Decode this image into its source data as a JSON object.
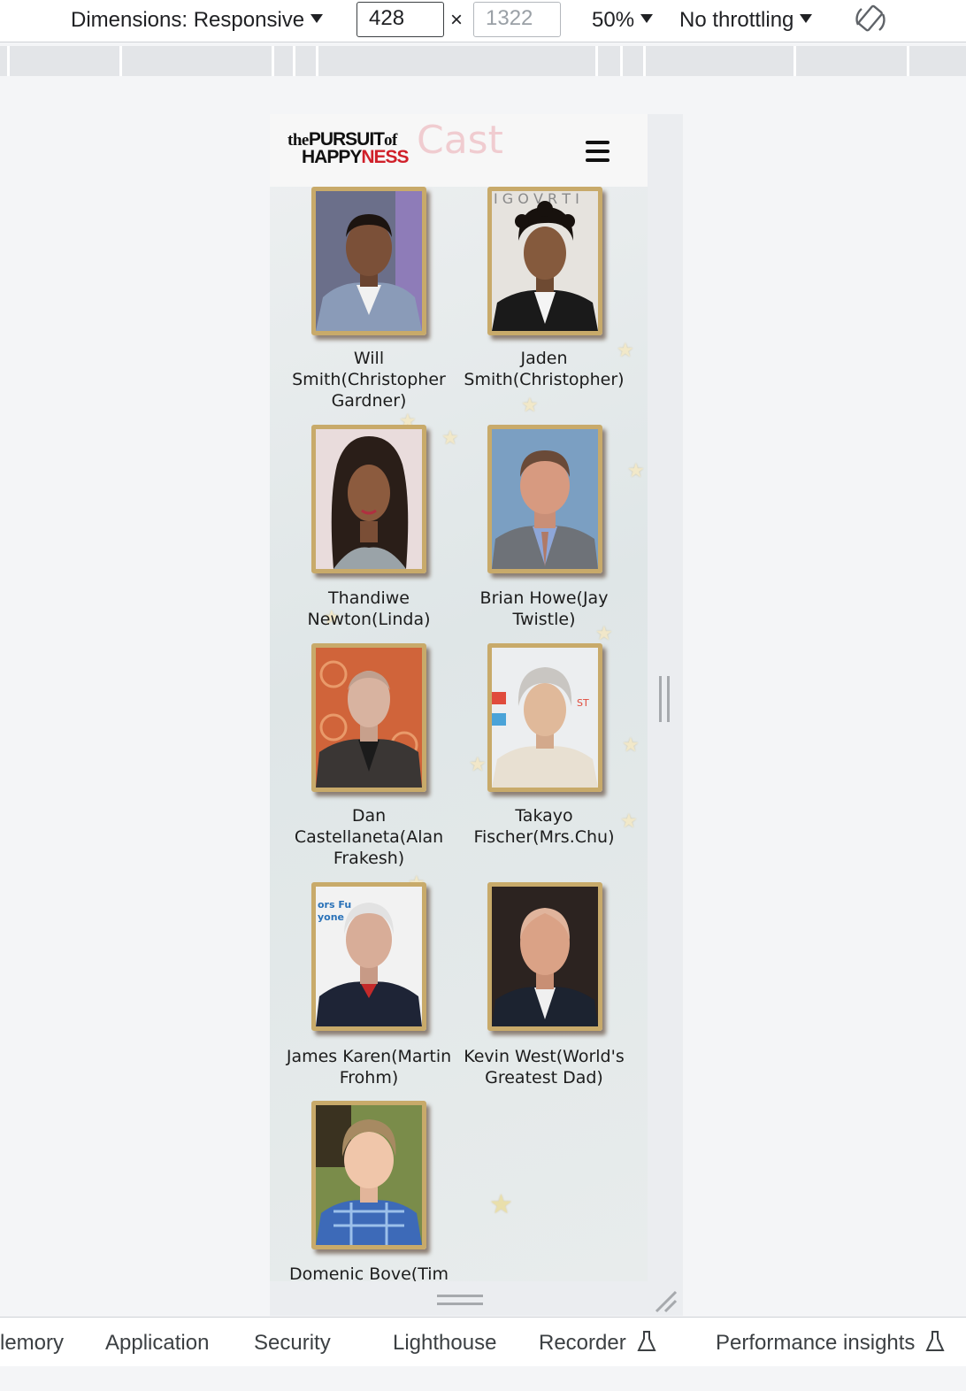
{
  "devtools": {
    "dimensions_label": "Dimensions: Responsive",
    "width_value": "428",
    "height_placeholder": "1322",
    "times_symbol": "×",
    "zoom": "50%",
    "throttling": "No throttling",
    "rotate_icon": "rotate-icon",
    "tabs": [
      {
        "label": "lemory"
      },
      {
        "label": "Application"
      },
      {
        "label": "Security"
      },
      {
        "label": "Lighthouse"
      },
      {
        "label": "Recorder"
      },
      {
        "label": "Performance insights"
      }
    ]
  },
  "site": {
    "logo_line1_a": "the",
    "logo_line1_b": "PURSUIT",
    "logo_line1_c": "of",
    "logo_line2_a": "HAPPY",
    "logo_line2_b": "NESS",
    "page_title": "Cast",
    "menu_icon": "hamburger-menu-icon"
  },
  "cast": [
    {
      "name": "Will Smith(Christopher Gardner)"
    },
    {
      "name": "Jaden Smith(Christopher)"
    },
    {
      "name": "Thandiwe Newton(Linda)"
    },
    {
      "name": "Brian Howe(Jay Twistle)"
    },
    {
      "name": "Dan Castellaneta(Alan Frakesh)"
    },
    {
      "name": "Takayo Fischer(Mrs.Chu)"
    },
    {
      "name": "James Karen(Martin Frohm)"
    },
    {
      "name": "Kevin West(World's Greatest Dad)"
    },
    {
      "name": "Domenic Bove(Tim"
    }
  ],
  "colors": {
    "frame_gold": "#c8aa6a",
    "logo_red": "#d0202a"
  }
}
